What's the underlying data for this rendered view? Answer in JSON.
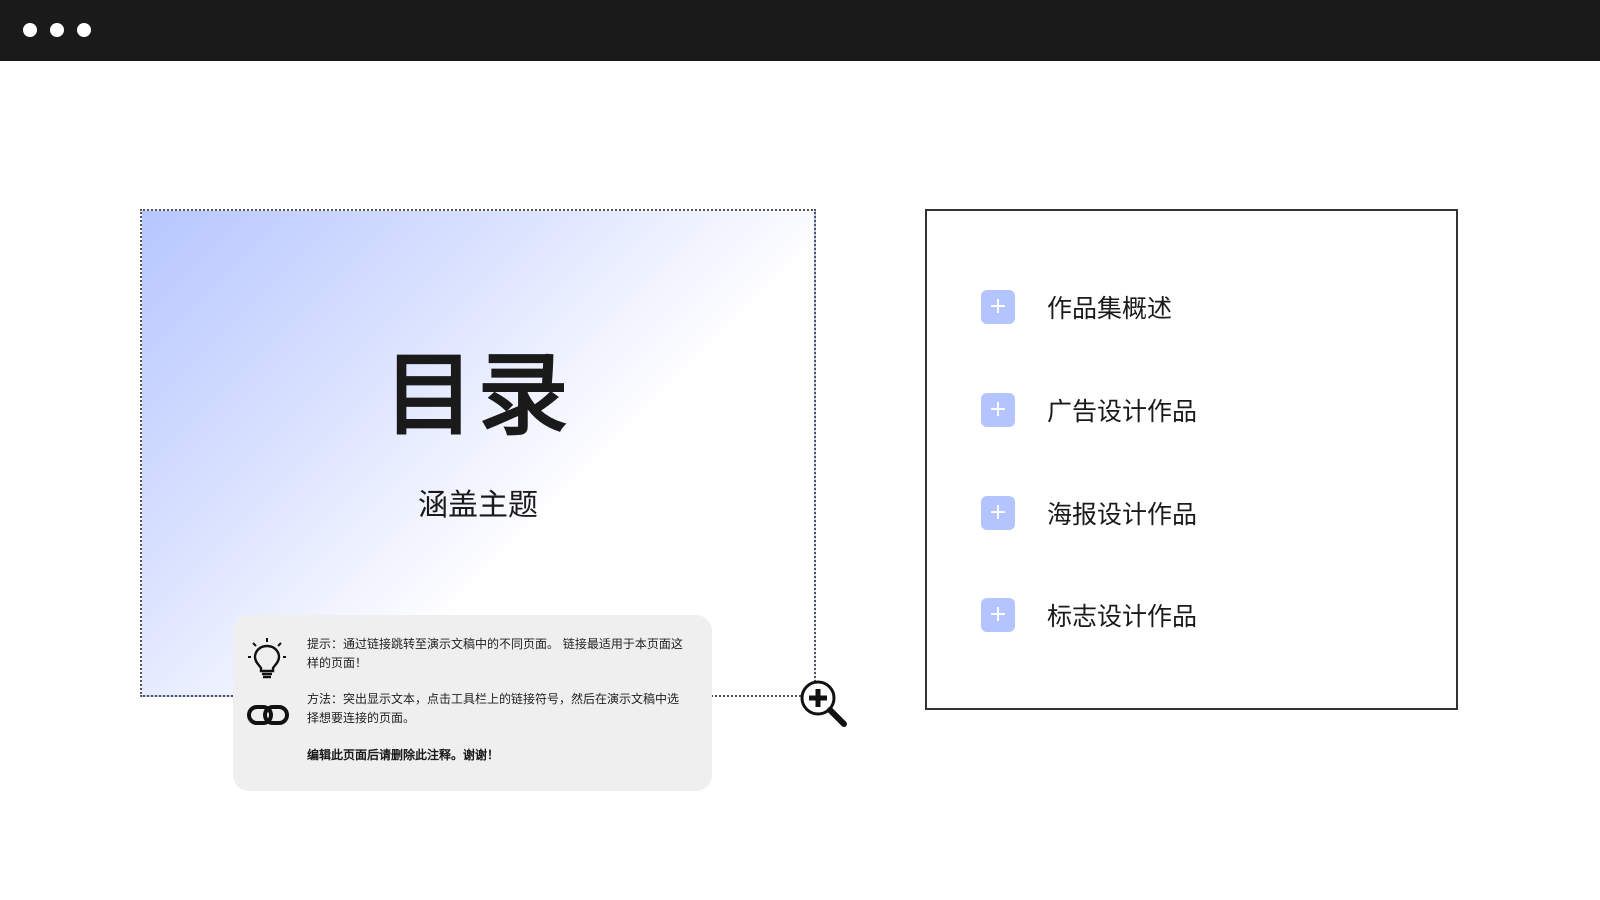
{
  "window": {
    "controls": [
      "window-dot",
      "window-dot",
      "window-dot"
    ]
  },
  "hero": {
    "title": "目录",
    "subtitle": "涵盖主题"
  },
  "note": {
    "tip": "提示：通过链接跳转至演示文稿中的不同页面。 链接最适用于本页面这样的页面！",
    "method": "方法：突出显示文本，点击工具栏上的链接符号，然后在演示文稿中选择想要连接的页面。",
    "reminder": "编辑此页面后请删除此注释。谢谢！",
    "icons": [
      "lightbulb-icon",
      "link-icon"
    ]
  },
  "toc": {
    "items": [
      {
        "label": "作品集概述",
        "icon": "plus-icon"
      },
      {
        "label": "广告设计作品",
        "icon": "plus-icon"
      },
      {
        "label": "海报设计作品",
        "icon": "plus-icon"
      },
      {
        "label": "标志设计作品",
        "icon": "plus-icon"
      }
    ]
  },
  "icons": {
    "zoom": "zoom-in-icon"
  },
  "colors": {
    "topbar": "#1a1a1a",
    "accent": "#b4c4ff",
    "gradient_start": "#b6c6ff",
    "note_background": "#efefef"
  }
}
